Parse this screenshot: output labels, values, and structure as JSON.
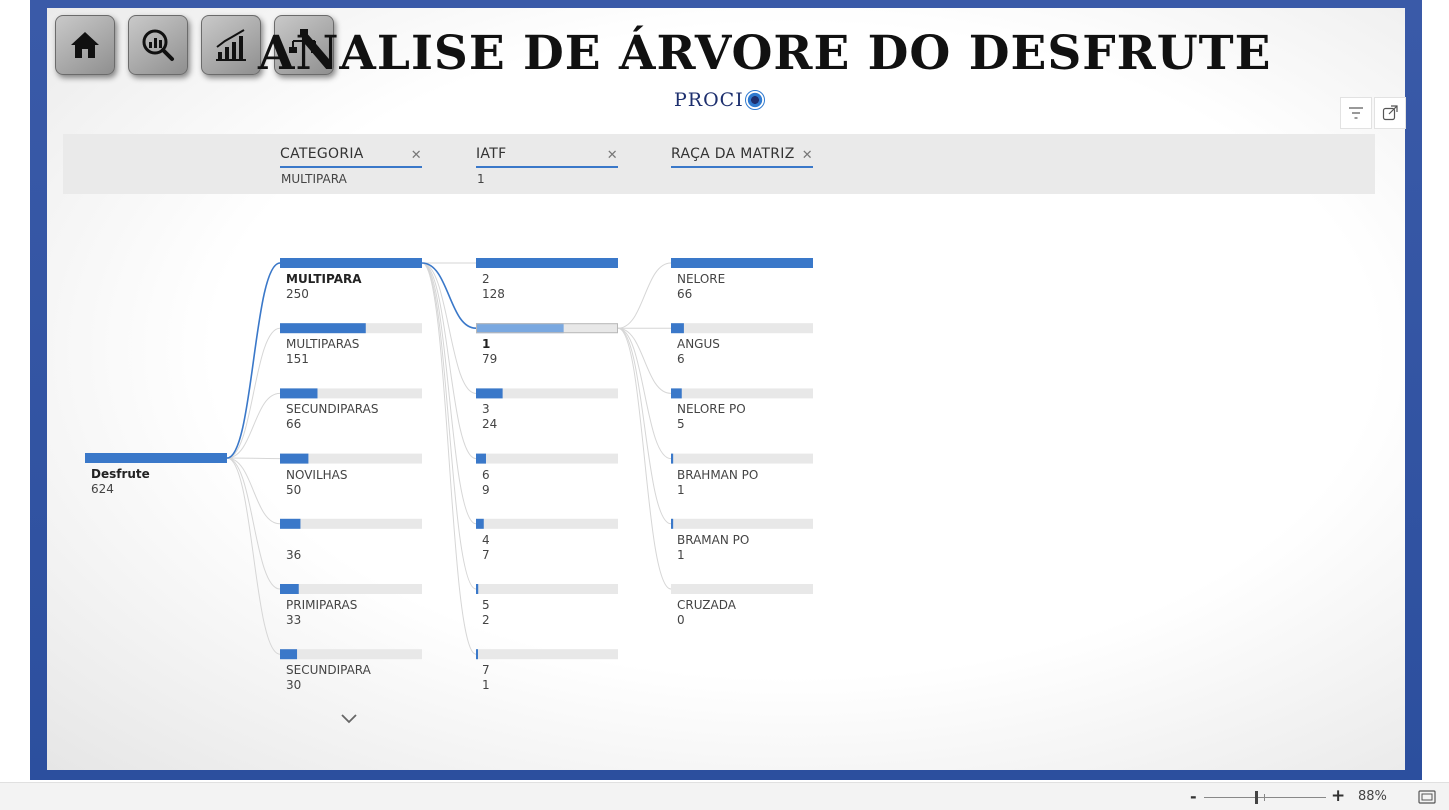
{
  "report": {
    "title": "ANALISE DE ÁRVORE DO DESFRUTE",
    "logo_text": "PROCI",
    "nav_buttons": [
      {
        "name": "home-button",
        "icon": "home-icon"
      },
      {
        "name": "analysis-button",
        "icon": "magnifier-chart-icon"
      },
      {
        "name": "growth-chart-button",
        "icon": "bar-chart-growth-icon"
      },
      {
        "name": "decomposition-tree-button",
        "icon": "tree-icon"
      }
    ]
  },
  "visual_toolbar": {
    "filter_icon": "filter-icon",
    "focus_icon": "focus-mode-icon"
  },
  "columns": [
    {
      "header": "CATEGORIA",
      "selected": "MULTIPARA"
    },
    {
      "header": "IATF",
      "selected": "1"
    },
    {
      "header": "RAÇA DA MATRIZ",
      "selected": ""
    }
  ],
  "chart_data": {
    "type": "decomposition-tree",
    "root": {
      "label": "Desfrute",
      "value": 624
    },
    "levels": [
      {
        "field": "CATEGORIA",
        "selected": "MULTIPARA",
        "nodes": [
          {
            "label": "MULTIPARA",
            "value": 250
          },
          {
            "label": "MULTIPARAS",
            "value": 151
          },
          {
            "label": "SECUNDIPARAS",
            "value": 66
          },
          {
            "label": "NOVILHAS",
            "value": 50
          },
          {
            "label": "",
            "value": 36
          },
          {
            "label": "PRIMIPARAS",
            "value": 33
          },
          {
            "label": "SECUNDIPARA",
            "value": 30
          }
        ]
      },
      {
        "field": "IATF",
        "selected": "1",
        "nodes": [
          {
            "label": "2",
            "value": 128
          },
          {
            "label": "1",
            "value": 79
          },
          {
            "label": "3",
            "value": 24
          },
          {
            "label": "6",
            "value": 9
          },
          {
            "label": "4",
            "value": 7
          },
          {
            "label": "5",
            "value": 2
          },
          {
            "label": "7",
            "value": 1
          }
        ]
      },
      {
        "field": "RAÇA DA MATRIZ",
        "selected": "",
        "nodes": [
          {
            "label": "NELORE",
            "value": 66
          },
          {
            "label": "ANGUS",
            "value": 6
          },
          {
            "label": "NELORE PO",
            "value": 5
          },
          {
            "label": "BRAHMAN PO",
            "value": 1
          },
          {
            "label": "BRAMAN PO",
            "value": 1
          },
          {
            "label": "CRUZADA",
            "value": 0
          }
        ]
      }
    ],
    "colors": {
      "bar": "#3a78c9",
      "bar_highlight": "#7aa8e0",
      "track": "#e8e8e8",
      "connector": "#3a78c9",
      "connector_faded": "#d6d6d6"
    }
  },
  "statusbar": {
    "zoom_minus": "-",
    "zoom_plus": "+",
    "zoom_level": "88%"
  }
}
